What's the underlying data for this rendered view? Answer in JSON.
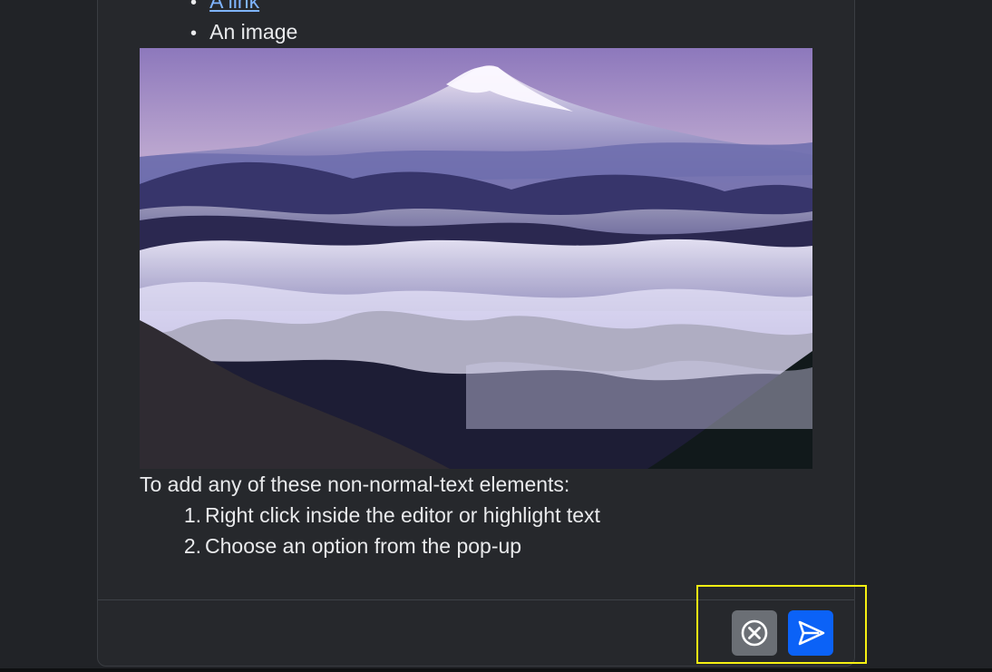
{
  "content": {
    "bullets": [
      {
        "text": "A link",
        "type": "link"
      },
      {
        "text": "An image",
        "type": "text"
      }
    ],
    "paragraph": "To add any of these non-normal-text elements:",
    "ordered_list": [
      {
        "number": "1.",
        "text": "Right click inside the editor or highlight text"
      },
      {
        "number": "2.",
        "text": "Choose an option from the pop-up"
      }
    ],
    "image": {
      "icon": "mountain-landscape-image"
    }
  },
  "actions": {
    "cancel_icon": "cancel-circle-icon",
    "send_icon": "send-icon"
  },
  "colors": {
    "background": "#212327",
    "card": "#26282c",
    "text": "#e9eaec",
    "link": "#7fb4ff",
    "cancel": "#6b6f75",
    "send": "#0b62f7",
    "highlight": "#f5ef12"
  }
}
